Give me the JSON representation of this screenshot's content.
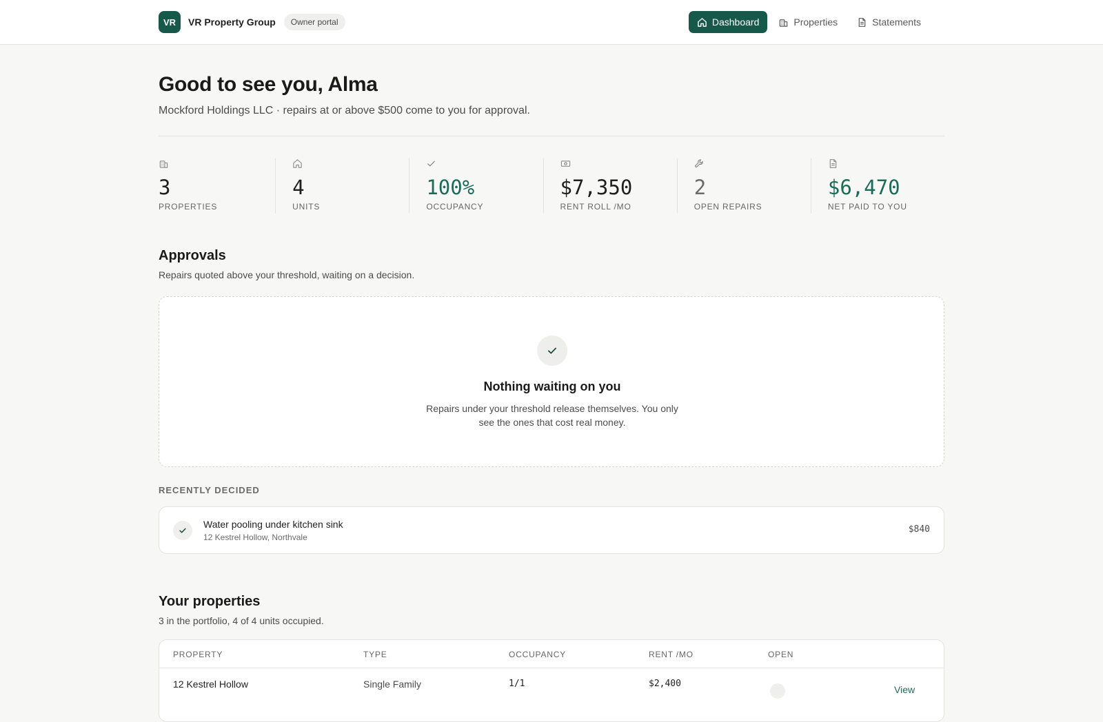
{
  "header": {
    "logo_initials": "VR",
    "brand_name": "VR Property Group",
    "portal_badge": "Owner portal",
    "nav": [
      {
        "label": "Dashboard",
        "icon": "home-icon",
        "active": true
      },
      {
        "label": "Properties",
        "icon": "building-icon",
        "active": false
      },
      {
        "label": "Statements",
        "icon": "document-icon",
        "active": false
      }
    ]
  },
  "welcome": {
    "greeting": "Good to see you, Alma",
    "subline": "Mockford Holdings LLC · repairs at or above $500 come to you for approval."
  },
  "stats": [
    {
      "icon": "building-icon",
      "value": "3",
      "label": "Properties",
      "tone": "default"
    },
    {
      "icon": "home-icon",
      "value": "4",
      "label": "Units",
      "tone": "default"
    },
    {
      "icon": "check-icon",
      "value": "100%",
      "label": "Occupancy",
      "tone": "green"
    },
    {
      "icon": "cash-icon",
      "value": "$7,350",
      "label": "Rent roll /mo",
      "tone": "default"
    },
    {
      "icon": "wrench-icon",
      "value": "2",
      "label": "Open repairs",
      "tone": "muted"
    },
    {
      "icon": "document-icon",
      "value": "$6,470",
      "label": "Net paid to you",
      "tone": "green"
    }
  ],
  "approvals": {
    "title": "Approvals",
    "subtitle": "Repairs quoted above your threshold, waiting on a decision.",
    "empty_title": "Nothing waiting on you",
    "empty_text": "Repairs under your threshold release themselves. You only see the ones that cost real money."
  },
  "recently_decided": {
    "caption": "RECENTLY DECIDED",
    "items": [
      {
        "title": "Water pooling under kitchen sink",
        "address": "12 Kestrel Hollow, Northvale",
        "amount": "$840"
      }
    ]
  },
  "properties": {
    "title": "Your properties",
    "subtitle": "3 in the portfolio, 4 of 4 units occupied.",
    "columns": [
      "Property",
      "Type",
      "Occupancy",
      "Rent /mo",
      "Open"
    ],
    "rows": [
      {
        "property": "12 Kestrel Hollow",
        "type": "Single Family",
        "occupancy": "1/1",
        "rent": "$2,400",
        "open": "",
        "action": "View"
      }
    ]
  },
  "colors": {
    "accent": "#16594a",
    "accent_text": "#1c6b58",
    "background": "#f7f7f6"
  }
}
